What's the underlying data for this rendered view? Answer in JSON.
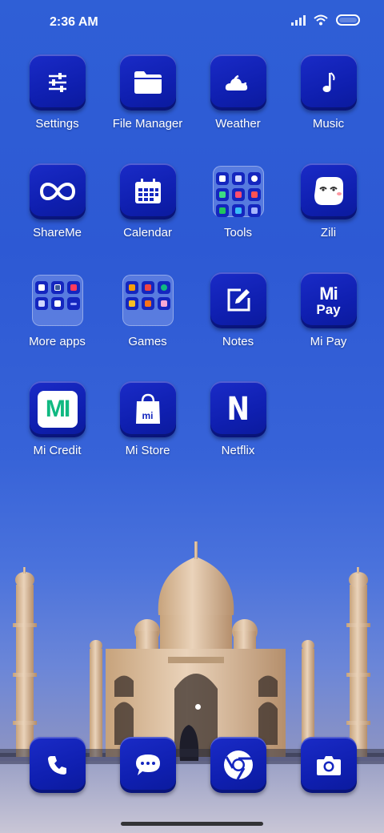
{
  "status_bar": {
    "time": "2:36 AM",
    "icons": [
      "signal-icon",
      "wifi-icon",
      "battery-icon"
    ]
  },
  "apps": [
    {
      "label": "Settings",
      "icon": "sliders-icon"
    },
    {
      "label": "File Manager",
      "icon": "folder-icon"
    },
    {
      "label": "Weather",
      "icon": "cloud-moon-icon"
    },
    {
      "label": "Music",
      "icon": "music-note-icon"
    },
    {
      "label": "ShareMe",
      "icon": "infinity-icon"
    },
    {
      "label": "Calendar",
      "icon": "calendar-icon"
    },
    {
      "label": "Tools",
      "icon": "folder-tools-icon"
    },
    {
      "label": "Zili",
      "icon": "face-icon"
    },
    {
      "label": "More apps",
      "icon": "folder-more-apps-icon"
    },
    {
      "label": "Games",
      "icon": "folder-games-icon"
    },
    {
      "label": "Notes",
      "icon": "note-edit-icon"
    },
    {
      "label": "Mi Pay",
      "icon": "mi-pay-icon"
    },
    {
      "label": "Mi Credit",
      "icon": "mi-credit-icon"
    },
    {
      "label": "Mi Store",
      "icon": "shopping-bag-icon"
    },
    {
      "label": "Netflix",
      "icon": "netflix-icon"
    }
  ],
  "mi_pay_logo": {
    "top": "Mi",
    "bottom": "Pay"
  },
  "mi_credit_logo": "MI",
  "mi_store_logo": "mi",
  "netflix_logo": "N",
  "dock": [
    {
      "name": "phone",
      "icon": "phone-icon"
    },
    {
      "name": "messages",
      "icon": "chat-icon"
    },
    {
      "name": "browser",
      "icon": "chrome-icon"
    },
    {
      "name": "camera",
      "icon": "camera-icon"
    }
  ],
  "wallpaper": "taj-mahal"
}
